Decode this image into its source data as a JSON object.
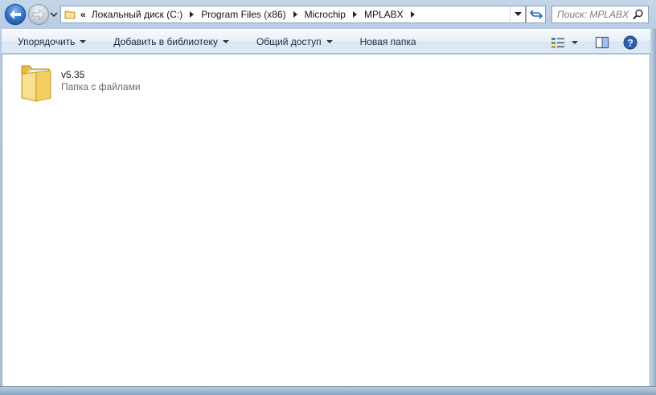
{
  "colors": {
    "accent": "#2b6cc0",
    "folder_yellow": "#f4d274",
    "content_bg": "#ffffff"
  },
  "navigation": {
    "back_icon": "back-arrow-icon",
    "forward_icon": "forward-arrow-icon",
    "recent_icon": "chevron-down-icon"
  },
  "address": {
    "overflow": "«",
    "crumbs": [
      {
        "label": "Локальный диск (C:)"
      },
      {
        "label": "Program Files (x86)"
      },
      {
        "label": "Microchip"
      },
      {
        "label": "MPLABX"
      }
    ]
  },
  "search": {
    "placeholder": "Поиск: MPLABX"
  },
  "commands": {
    "organize": "Упорядочить",
    "add_library": "Добавить в библиотеку",
    "share": "Общий доступ",
    "new_folder": "Новая папка"
  },
  "view": {
    "views_icon": "view-options-icon",
    "preview_icon": "preview-pane-icon",
    "help_icon": "help-icon"
  },
  "items": [
    {
      "name": "v5.35",
      "type": "Папка с файлами",
      "icon": "folder-icon"
    }
  ]
}
